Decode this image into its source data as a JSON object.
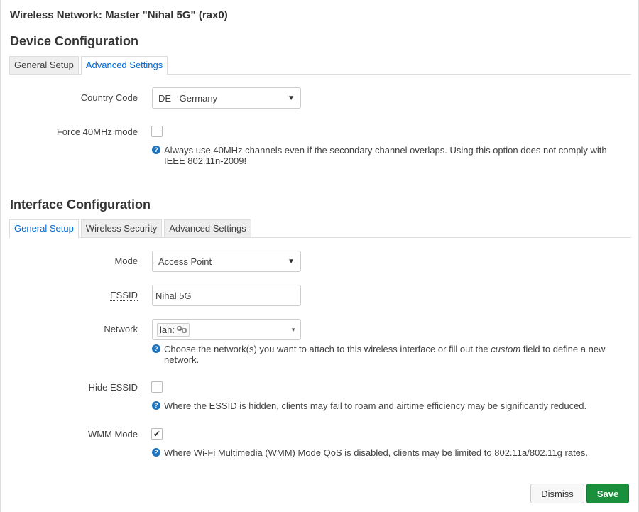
{
  "modal": {
    "title": "Wireless Network: Master \"Nihal 5G\" (rax0)"
  },
  "device": {
    "title": "Device Configuration",
    "tabs": [
      "General Setup",
      "Advanced Settings"
    ],
    "country_label": "Country Code",
    "country_value": "DE - Germany",
    "force40_label": "Force 40MHz mode",
    "force40_checked": false,
    "force40_help": "Always use 40MHz channels even if the secondary channel overlaps. Using this option does not comply with IEEE 802.11n-2009!"
  },
  "iface": {
    "title": "Interface Configuration",
    "tabs": [
      "General Setup",
      "Wireless Security",
      "Advanced Settings"
    ],
    "mode_label": "Mode",
    "mode_value": "Access Point",
    "essid_label": "ESSID",
    "essid_value": "Nihal 5G",
    "network_label": "Network",
    "network_value": "lan:",
    "network_help_pre": "Choose the network(s) you want to attach to this wireless interface or fill out the ",
    "network_help_em": "custom",
    "network_help_post": " field to define a new network.",
    "hide_label_pre": "Hide ",
    "hide_label_u": "ESSID",
    "hide_checked": false,
    "hide_help": "Where the ESSID is hidden, clients may fail to roam and airtime efficiency may be significantly reduced.",
    "wmm_label": "WMM Mode",
    "wmm_checked": true,
    "wmm_help": "Where Wi-Fi Multimedia (WMM) Mode QoS is disabled, clients may be limited to 802.11a/802.11g rates."
  },
  "icons": {
    "help": "help-icon",
    "caret": "chevron-down-icon",
    "network": "network-icon",
    "check": "checkmark-icon"
  },
  "colors": {
    "accent": "#0069d6",
    "save": "#1a8f3c",
    "help_icon": "#1e73be"
  },
  "buttons": {
    "dismiss": "Dismiss",
    "save": "Save"
  }
}
